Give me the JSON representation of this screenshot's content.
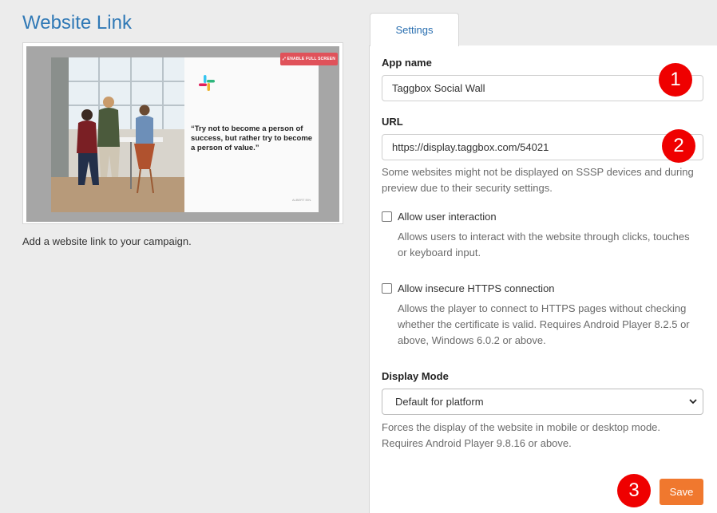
{
  "page": {
    "title": "Website Link",
    "intro": "Add a website link to your campaign."
  },
  "preview": {
    "fullscreen_label": "ENABLE FULL SCREEN",
    "quote": "“Try not to become a person of success, but rather try to become a person of value.”",
    "small_caption": "ALBERT EIN."
  },
  "tabs": [
    {
      "label": "Settings",
      "active": true
    }
  ],
  "settings": {
    "app_name": {
      "label": "App name",
      "value": "Taggbox Social Wall"
    },
    "url": {
      "label": "URL",
      "value": "https://display.taggbox.com/54021",
      "help": "Some websites might not be displayed on SSSP devices and during preview due to their security settings."
    },
    "allow_interaction": {
      "label": "Allow user interaction",
      "checked": false,
      "help": "Allows users to interact with the website through clicks, touches or keyboard input."
    },
    "allow_insecure": {
      "label": "Allow insecure HTTPS connection",
      "checked": false,
      "help": "Allows the player to connect to HTTPS pages without checking whether the certificate is valid. Requires Android Player 8.2.5 or above, Windows 6.0.2 or above."
    },
    "display_mode": {
      "label": "Display Mode",
      "selected": "Default for platform",
      "help": "Forces the display of the website in mobile or desktop mode. Requires Android Player 9.8.16 or above."
    },
    "save_label": "Save"
  },
  "badges": [
    "1",
    "2",
    "3"
  ],
  "colors": {
    "title": "#3079b6",
    "badge": "#ef0000",
    "save": "#f0782e",
    "fullscreen": "#e0525a"
  },
  "icons": [
    "slack-logo-icon",
    "expand-icon",
    "chevron-down-icon"
  ]
}
